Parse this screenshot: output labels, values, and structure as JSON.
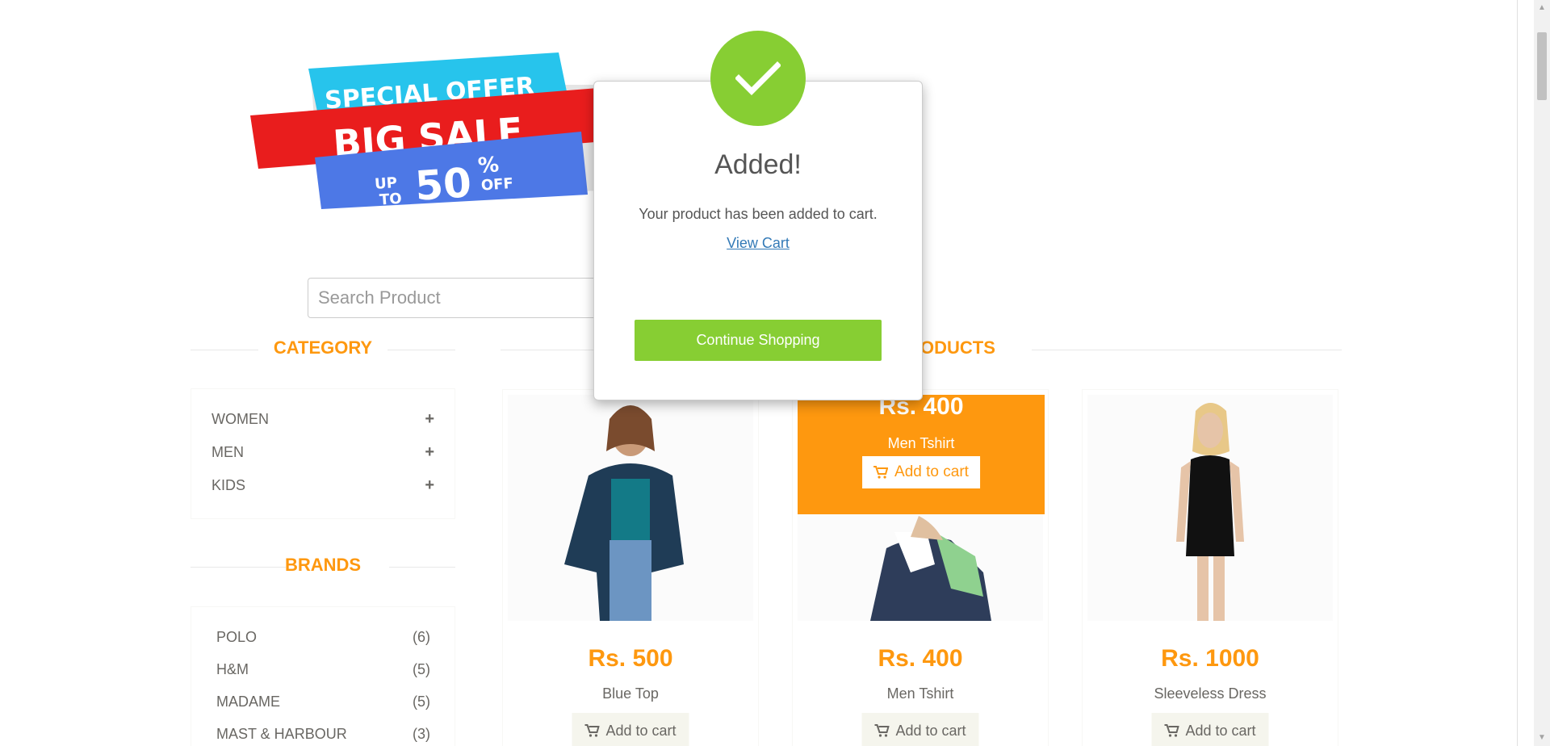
{
  "banner": {
    "line1": "SPECIAL OFFER",
    "line2": "BIG SALE",
    "line3_up": "UP",
    "line3_to": "TO",
    "line3_num": "50",
    "line3_pct": "%",
    "line3_off": "OFF"
  },
  "search": {
    "placeholder": "Search Product"
  },
  "sidebar": {
    "category_title": "CATEGORY",
    "categories": [
      {
        "label": "WOMEN"
      },
      {
        "label": "MEN"
      },
      {
        "label": "KIDS"
      }
    ],
    "brands_title": "BRANDS",
    "brands": [
      {
        "label": "POLO",
        "count": "(6)"
      },
      {
        "label": "H&M",
        "count": "(5)"
      },
      {
        "label": "MADAME",
        "count": "(5)"
      },
      {
        "label": "MAST & HARBOUR",
        "count": "(3)"
      }
    ]
  },
  "products_section": {
    "title_visible": "ODUCTS"
  },
  "products": [
    {
      "price": "Rs. 500",
      "name": "Blue Top",
      "cart_label": "Add to cart"
    },
    {
      "price": "Rs. 400",
      "name": "Men Tshirt",
      "cart_label": "Add to cart",
      "overlay": {
        "price": "Rs. 400",
        "name": "Men Tshirt",
        "cart_label": "Add to cart"
      }
    },
    {
      "price": "Rs. 1000",
      "name": "Sleeveless Dress",
      "cart_label": "Add to cart"
    }
  ],
  "modal": {
    "title": "Added!",
    "body": "Your product has been added to cart.",
    "link": "View Cart",
    "button": "Continue Shopping"
  },
  "colors": {
    "accent": "#FE980F",
    "success": "#87CE33",
    "link": "#337ab7"
  },
  "icons": [
    "check-icon",
    "plus-icon",
    "shopping-cart-icon"
  ]
}
